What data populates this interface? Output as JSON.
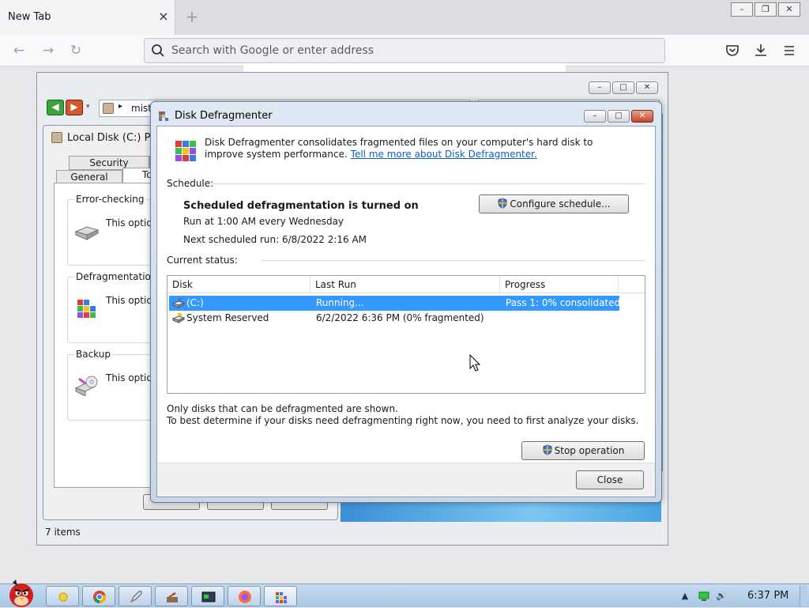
{
  "browser": {
    "tab_title": "New Tab",
    "tab_close": "×",
    "new_tab": "+",
    "url_placeholder": "Search with Google or enter address"
  },
  "explorer": {
    "address_text": "mist",
    "status_items": "7 items",
    "properties": {
      "title": "Local Disk (C:) Pro",
      "tabs": [
        "Security",
        "General",
        "To"
      ],
      "groups": [
        {
          "title": "Error-checking",
          "text": "This option v"
        },
        {
          "title": "Defragmentation",
          "text": "This option v"
        },
        {
          "title": "Backup",
          "text": "This option v"
        }
      ]
    }
  },
  "defrag": {
    "title": "Disk Defragmenter",
    "intro_text": "Disk Defragmenter consolidates fragmented files on your computer's hard disk to improve system performance.",
    "intro_link": "Tell me more about Disk Defragmenter.",
    "schedule_label": "Schedule:",
    "schedule_status": "Scheduled defragmentation is turned on",
    "run_at": "Run at 1:00 AM every Wednesday",
    "next_run": "Next scheduled run: 6/8/2022 2:16 AM",
    "configure_button": "Configure schedule...",
    "current_status_label": "Current status:",
    "columns": [
      "Disk",
      "Last Run",
      "Progress"
    ],
    "rows": [
      {
        "disk": "(C:)",
        "last_run": "Running...",
        "progress": "Pass 1: 0% consolidated",
        "selected": true
      },
      {
        "disk": "System Reserved",
        "last_run": "6/2/2022 6:36 PM (0% fragmented)",
        "progress": "",
        "selected": false
      }
    ],
    "note_1": "Only disks that can be defragmented are shown.",
    "note_2": "To best determine if your disks need defragmenting right now, you need to first analyze your disks.",
    "stop_button": "Stop operation",
    "close_button": "Close"
  },
  "taskbar": {
    "clock": "6:37 PM"
  },
  "colors": {
    "selection": "#3399ff",
    "link": "#0b5fc7",
    "taskbar": "#b7cee6"
  }
}
